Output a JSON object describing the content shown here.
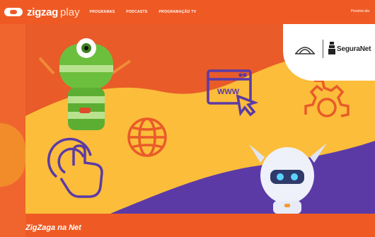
{
  "brand": {
    "name_bold": "zigzag",
    "name_light": "play"
  },
  "nav": {
    "items": [
      {
        "label": "Programas"
      },
      {
        "label": "Podcasts"
      },
      {
        "label": "Programação TV"
      }
    ],
    "right_label": "Proxima ida"
  },
  "hero": {
    "url_text": "WWW",
    "partner_label": "SeguraNet",
    "colors": {
      "orange": "#e95b29",
      "yellow": "#fbbd3a",
      "purple": "#5b3aa6",
      "white": "#ffffff"
    }
  },
  "caption": {
    "title": "ZigZaga na Net"
  },
  "icons": [
    "globe-icon",
    "browser-window-icon",
    "touch-hand-icon",
    "gear-icon",
    "robot-character",
    "green-mascot-character"
  ]
}
